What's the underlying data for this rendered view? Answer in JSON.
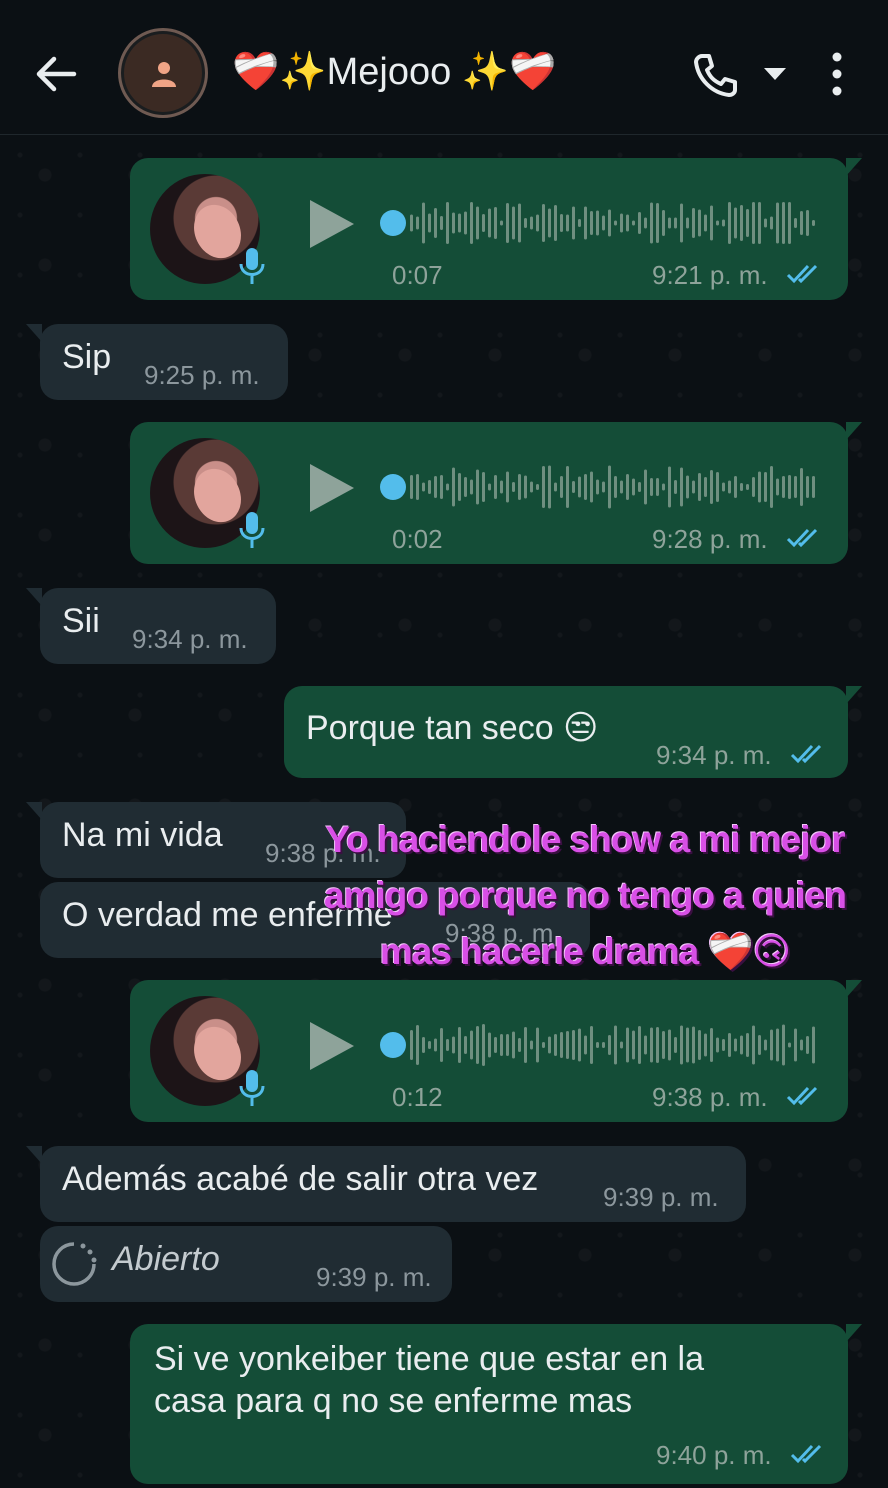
{
  "header": {
    "contact_name": "❤️‍🩹✨Mejooo ✨❤️‍🩹"
  },
  "messages": [
    {
      "type": "voice",
      "direction": "out",
      "duration": "0:07",
      "time": "9:21 p. m.",
      "status": "read"
    },
    {
      "type": "text",
      "direction": "in",
      "text": "Sip",
      "time": "9:25 p. m."
    },
    {
      "type": "voice",
      "direction": "out",
      "duration": "0:02",
      "time": "9:28 p. m.",
      "status": "read"
    },
    {
      "type": "text",
      "direction": "in",
      "text": "Sii",
      "time": "9:34 p. m."
    },
    {
      "type": "text",
      "direction": "out",
      "text": "Porque tan seco 😒",
      "time": "9:34 p. m.",
      "status": "read"
    },
    {
      "type": "text",
      "direction": "in",
      "text": "Na mi vida",
      "time": "9:38 p. m."
    },
    {
      "type": "text",
      "direction": "in",
      "text": "O verdad me enferme",
      "time": "9:38 p. m."
    },
    {
      "type": "voice",
      "direction": "out",
      "duration": "0:12",
      "time": "9:38 p. m.",
      "status": "read"
    },
    {
      "type": "text",
      "direction": "in",
      "text": "Además acabé de salir otra vez",
      "time": "9:39 p. m."
    },
    {
      "type": "view_once",
      "direction": "in",
      "text": "Abierto",
      "time": "9:39 p. m."
    },
    {
      "type": "text",
      "direction": "out",
      "text_line1": "Si ve yonkeiber tiene que estar en la",
      "text_line2": "casa para q no se enferme mas",
      "time": "9:40 p. m.",
      "status": "read"
    }
  ],
  "overlay": {
    "line1": "Yo haciendole show a mi mejor",
    "line2": "amigo porque no tengo a quien",
    "line3": "mas hacerle drama ❤️‍🩹🙃"
  },
  "colors": {
    "background": "#0b1014",
    "incoming_bubble": "#202c33",
    "outgoing_bubble": "#144d37",
    "read_ticks": "#53bdeb",
    "overlay_text": "#d84fe6"
  }
}
